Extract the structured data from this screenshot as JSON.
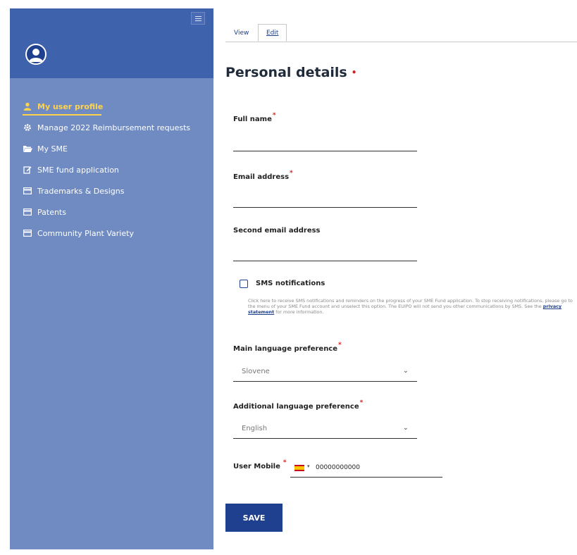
{
  "sidebar": {
    "items": [
      {
        "label": "My user profile",
        "icon": "user-icon",
        "active": true
      },
      {
        "label": "Manage 2022 Reimbursement requests",
        "icon": "gear-icon",
        "active": false
      },
      {
        "label": "My SME",
        "icon": "folder-open-icon",
        "active": false
      },
      {
        "label": "SME fund application",
        "icon": "edit-icon",
        "active": false
      },
      {
        "label": "Trademarks & Designs",
        "icon": "card-icon",
        "active": false
      },
      {
        "label": "Patents",
        "icon": "card-icon",
        "active": false
      },
      {
        "label": "Community Plant Variety",
        "icon": "card-icon",
        "active": false
      }
    ]
  },
  "tabs": {
    "view": "View",
    "edit": "Edit",
    "active": "Edit"
  },
  "form": {
    "title": "Personal details",
    "full_name": {
      "label": "Full name",
      "value": ""
    },
    "email": {
      "label": "Email address",
      "value": ""
    },
    "second_email": {
      "label": "Second email address",
      "value": ""
    },
    "sms": {
      "label": "SMS notifications",
      "checked": false,
      "help_before": "Click here to receive SMS notifications and reminders on the progress of your SME Fund application. To stop receiving notifications, please go to the menu of your SME Fund account and unselect this option. The EUIPO will not send you other communications by SMS. See the ",
      "help_link": "privacy statement",
      "help_after": " for more information."
    },
    "main_language": {
      "label": "Main language preference",
      "value": "Slovene"
    },
    "additional_language": {
      "label": "Additional language preference",
      "value": "English"
    },
    "mobile": {
      "label": "User Mobile",
      "country": "ES",
      "value": "00000000000"
    },
    "save_label": "SAVE"
  },
  "colors": {
    "sidebar_top": "#3f62ad",
    "sidebar_body": "#6f8bc2",
    "active_nav": "#ffd34c",
    "button": "#1f3f8f",
    "required_star": "#d92020"
  }
}
